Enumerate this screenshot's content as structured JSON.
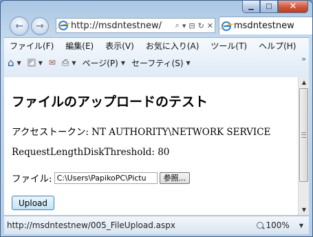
{
  "window": {
    "caption_buttons": {
      "minimize_icon": "minimize-icon",
      "maximize_icon": "maximize-icon",
      "close_icon": "close-icon"
    }
  },
  "address_bar": {
    "url": "http://msdntestnew/",
    "icons": [
      "ie-logo-icon",
      "search-icon",
      "dropdown-icon",
      "compat-view-icon",
      "refresh-icon",
      "stop-icon"
    ]
  },
  "tab": {
    "title": "msdntestnew"
  },
  "menu": {
    "items": [
      "ファイル(F)",
      "編集(E)",
      "表示(V)",
      "お気に入り(A)",
      "ツール(T)",
      "ヘルプ(H)"
    ]
  },
  "toolbar": {
    "page_label": "ページ(P)",
    "safety_label": "セーフティ(S)",
    "icons": [
      "home-icon",
      "feeds-icon",
      "mail-icon",
      "print-icon"
    ]
  },
  "page": {
    "title": "ファイルのアップロードのテスト",
    "token_label": "アクセストークン:",
    "token_value": "NT AUTHORITY\\NETWORK SERVICE",
    "threshold_label": "RequestLengthDiskThreshold:",
    "threshold_value": "80",
    "file_label": "ファイル:",
    "file_value": "C:\\Users\\PapikoPC\\Pictu",
    "browse_label": "参照...",
    "upload_label": "Upload"
  },
  "status": {
    "url": "http://msdntestnew/005_FileUpload.aspx",
    "zoom": "100%"
  },
  "scrollbar": {
    "position": 0
  }
}
